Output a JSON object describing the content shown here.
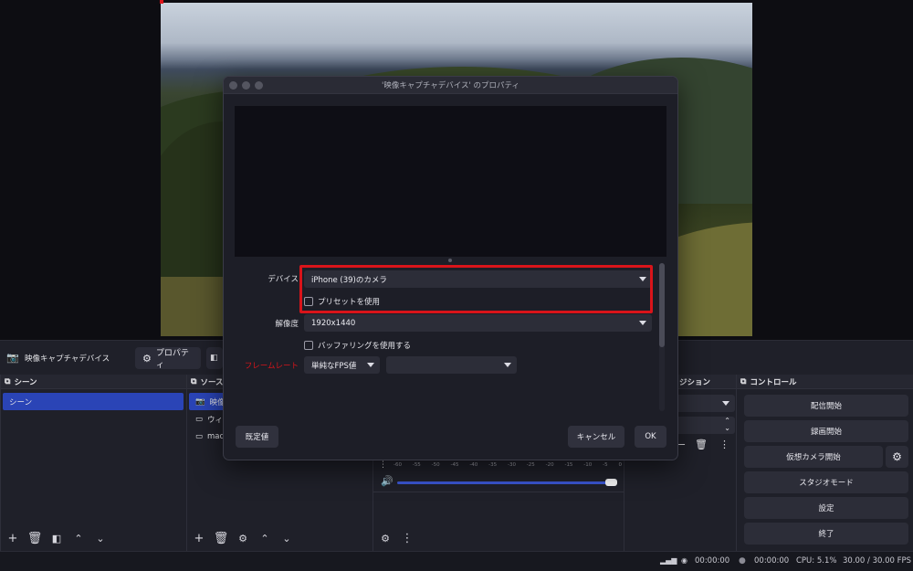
{
  "source_toolbar": {
    "source_name": "映像キャプチャデバイス",
    "properties_label": "プロパティ"
  },
  "scenes": {
    "title": "シーン",
    "items": [
      "シーン"
    ]
  },
  "sources": {
    "title": "ソース",
    "items": [
      "映像キ",
      "ウィ",
      "mac"
    ]
  },
  "transitions": {
    "title": "ジション"
  },
  "mixer": {
    "ticks": [
      "-60",
      "-55",
      "-50",
      "-45",
      "-40",
      "-35",
      "-30",
      "-25",
      "-20",
      "-15",
      "-10",
      "-5",
      "0"
    ]
  },
  "controls": {
    "title": "コントロール",
    "start_streaming": "配信開始",
    "start_recording": "録画開始",
    "start_virtual_camera": "仮想カメラ開始",
    "studio_mode": "スタジオモード",
    "settings": "設定",
    "exit": "終了"
  },
  "status_bar": {
    "stream_time": "00:00:00",
    "record_time": "00:00:00",
    "cpu": "CPU: 5.1%",
    "fps": "30.00 / 30.00 FPS"
  },
  "dialog": {
    "title": "'映像キャプチャデバイス' のプロパティ",
    "device_label": "デバイス",
    "device_value": "iPhone (39)のカメラ",
    "use_preset_label": "プリセットを使用",
    "resolution_label": "解像度",
    "resolution_value": "1920x1440",
    "buffering_label": "バッファリングを使用する",
    "framerate_label": "フレームレート",
    "framerate_value": "単純なFPS値",
    "framerate_value2": "",
    "defaults_label": "既定値",
    "cancel_label": "キャンセル",
    "ok_label": "OK"
  },
  "colors": {
    "accent_blue": "#2a44b6",
    "highlight_red": "#d9141a",
    "framerate_label_red": "#d9141a"
  }
}
